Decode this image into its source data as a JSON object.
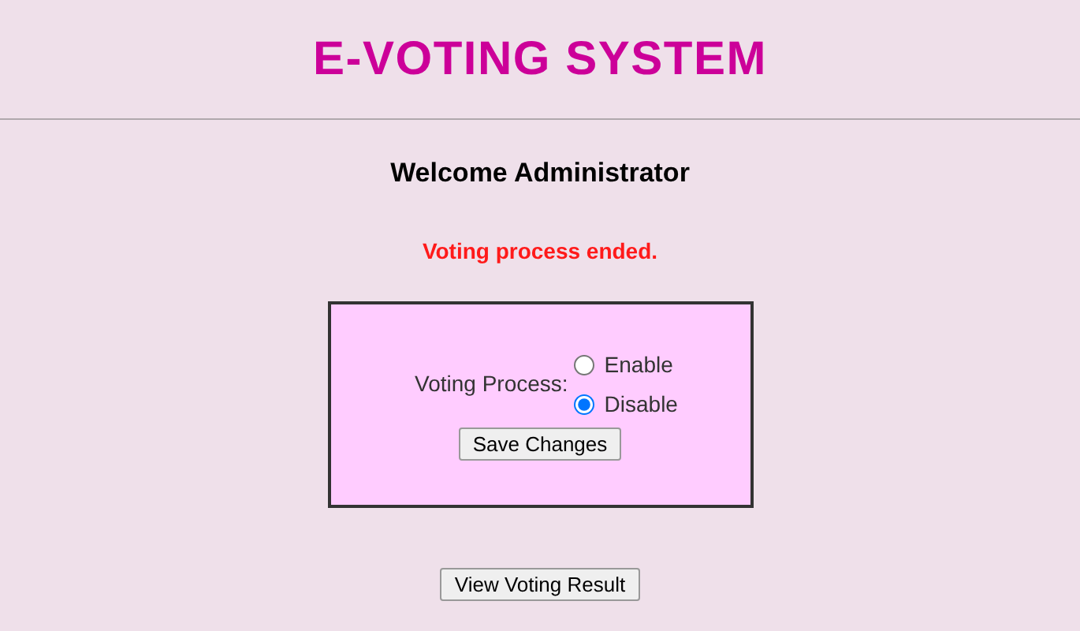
{
  "header": {
    "title": "E-VOTING SYSTEM"
  },
  "welcome": "Welcome Administrator",
  "status_message": "Voting process ended.",
  "settings": {
    "label": "Voting Process:",
    "options": [
      {
        "label": "Enable",
        "selected": false
      },
      {
        "label": "Disable",
        "selected": true
      }
    ],
    "save_button": "Save Changes"
  },
  "result_button": "View Voting Result"
}
